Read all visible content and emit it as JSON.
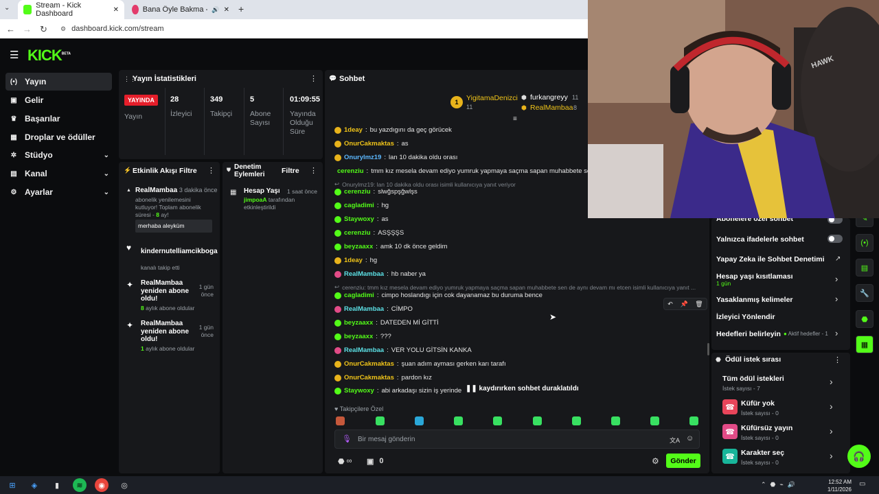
{
  "browser": {
    "tabs": [
      {
        "title": "Stream - Kick Dashboard"
      },
      {
        "title": "Bana Öyle Bakma - YouTub"
      }
    ],
    "new_tab": "+",
    "url": "dashboard.kick.com/stream"
  },
  "brand": {
    "logo": "KICK",
    "beta": "BETA",
    "accent": "#53fc18"
  },
  "sidebar": {
    "items": [
      {
        "label": "Yayın",
        "icon": "broadcast-icon"
      },
      {
        "label": "Gelir",
        "icon": "revenue-icon"
      },
      {
        "label": "Başarılar",
        "icon": "trophy-icon"
      },
      {
        "label": "Droplar ve ödüller",
        "icon": "gift-icon"
      },
      {
        "label": "Stüdyo",
        "icon": "studio-icon"
      },
      {
        "label": "Kanal",
        "icon": "channel-icon"
      },
      {
        "label": "Ayarlar",
        "icon": "gear-icon"
      }
    ]
  },
  "stats": {
    "title": "Yayın İstatistikleri",
    "live_badge": "YAYINDA",
    "live_label": "Yayın",
    "items": [
      {
        "value": "28",
        "label": "İzleyici"
      },
      {
        "value": "349",
        "label": "Takipçi"
      },
      {
        "value": "5",
        "label": "Abone Sayısı"
      },
      {
        "value": "01:09:55",
        "label": "Yayında Olduğu Süre"
      }
    ]
  },
  "activity": {
    "title": "Etkinlik Akışı",
    "filter": "Filtre",
    "events": [
      {
        "user": "RealMambaa",
        "time": "3 dakika önce",
        "text": "abonelik yenilemesini kutluyor! Toplam abonelik süresi - ",
        "months": "8",
        "suffix": " ay!",
        "message": "merhaba aleyküm"
      },
      {
        "user": "kindernutelliamcikboga",
        "text": "kanalı takip etti"
      },
      {
        "user": "RealMambaa yeniden abone oldu!",
        "time": "1 gün önce",
        "months": "8",
        "text": " aylık abone oldular"
      },
      {
        "user": "RealMambaa yeniden abone oldu!",
        "time": "1 gün önce",
        "months": "1",
        "text": " aylık abone oldular"
      }
    ]
  },
  "mod_actions": {
    "title": "Denetim Eylemleri",
    "filter": "Filtre",
    "items": [
      {
        "title": "Hesap Yaşı",
        "time": "1 saat önce",
        "actor": "jimpoaA",
        "text": "tarafından etkinleştirildi"
      }
    ]
  },
  "chat": {
    "title": "Sohbet",
    "pinned_users": [
      {
        "name": "YigitamaDenizci",
        "badge": "11"
      },
      {
        "name": "furkangreyy",
        "badge": "11"
      },
      {
        "name": "RealMambaa",
        "badge": "8"
      }
    ],
    "messages": [
      {
        "user": "1deay",
        "text": "bu yazdıgını da geç görücek",
        "color": "#f0c419"
      },
      {
        "user": "OnurCakmaktas",
        "text": "as",
        "color": "#f0c419"
      },
      {
        "user": "Onurylmz19",
        "text": "lan 10 dakika oldu orası",
        "color": "#5cb8ff"
      },
      {
        "user": "cerenziu",
        "text": "tmm kız mesela devam ediyo yumruk yapmaya saçma sapan muhabbete sen de",
        "color": "#53fc18"
      },
      {
        "reply": "Onurylmz19: lan 10 dakika oldu orası isimli kullanıcıya yanıt veriyor"
      },
      {
        "user": "cerenziu",
        "text": "slwğspşğwlşs",
        "color": "#53fc18"
      },
      {
        "user": "cagladimi",
        "text": "hg",
        "color": "#53fc18"
      },
      {
        "user": "Staywoxy",
        "text": "as",
        "color": "#53fc18"
      },
      {
        "user": "cerenziu",
        "text": "ASŞŞŞS",
        "color": "#53fc18"
      },
      {
        "user": "beyzaaxx",
        "text": "amk 10 dk önce geldim",
        "color": "#53fc18"
      },
      {
        "user": "1deay",
        "text": "hg",
        "color": "#f0c419"
      },
      {
        "user": "RealMambaa",
        "text": "hb naber ya",
        "color": "#5ce1e6"
      },
      {
        "reply": "cerenziu: tmm kız mesela devam ediyo yumruk yapmaya saçma sapan muhabbete sen de aynı devam mı etcen isimli kullanıcıya yanıt ..."
      },
      {
        "user": "cagladimi",
        "text": "cimpo hoslandıgı için cok dayanamaz bu duruma bence",
        "color": "#53fc18"
      },
      {
        "user": "RealMambaa",
        "text": "CİMPO",
        "color": "#5ce1e6"
      },
      {
        "user": "beyzaaxx",
        "text": "DATEDEN Mİ GİTTİ",
        "color": "#53fc18"
      },
      {
        "user": "beyzaaxx",
        "text": "???",
        "color": "#53fc18"
      },
      {
        "user": "RealMambaa",
        "text": "VER YOLU GİTSİN KANKA",
        "color": "#5ce1e6"
      },
      {
        "user": "OnurCakmaktas",
        "text": "şuan adım ayması gerken karı tarafı",
        "color": "#f0c419"
      },
      {
        "user": "OnurCakmaktas",
        "text": "pardon kız",
        "color": "#f0c419"
      },
      {
        "user": "Staywoxy",
        "text": "abi arkadaşı sizin iş yerinden t",
        "color": "#53fc18"
      }
    ],
    "paused": "kaydırırken sohbet duraklatıldı",
    "followers_only": "Takipçilere Özel",
    "input_placeholder": "Bir mesaj gönderin",
    "send": "Gönder",
    "points": "∞",
    "drops_count": "0"
  },
  "mod_settings": {
    "items": [
      {
        "label": "Abonelere özel sohbet"
      },
      {
        "label": "Yalnızca ifadelerle sohbet"
      },
      {
        "label": "Yapay Zeka ile Sohbet Denetimi"
      },
      {
        "label": "Hesap yaşı kısıtlaması",
        "sub": "1 gün"
      },
      {
        "label": "Yasaklanmış kelimeler"
      },
      {
        "label": "İzleyici Yönlendir"
      },
      {
        "label": "Hedefleri belirleyin",
        "status": "Aktif hedefler - 1"
      }
    ]
  },
  "rewards": {
    "title": "Ödül istek sırası",
    "items": [
      {
        "title": "Tüm ödül istekleri",
        "sub": "İstek sayısı - 7"
      },
      {
        "title": "Küfür yok",
        "sub": "İstek sayısı - 0",
        "color": "#e8455a"
      },
      {
        "title": "Küfürsüz yayın",
        "sub": "İstek sayısı - 0",
        "color": "#e24b87"
      },
      {
        "title": "Karakter seç",
        "sub": "İstek sayısı - 0",
        "color": "#18b59a"
      }
    ]
  },
  "webcam": {
    "chair_brand": "HAWK"
  },
  "taskbar": {
    "time": "12:52 AM",
    "date": "1/11/2026"
  }
}
